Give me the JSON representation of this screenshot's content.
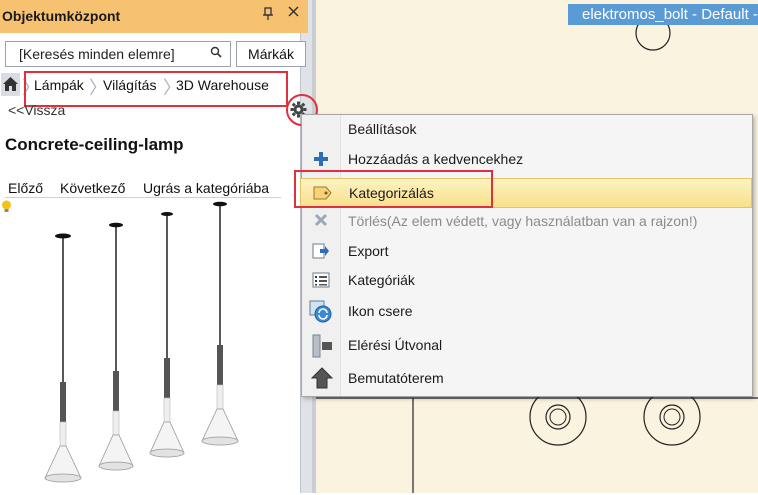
{
  "panel": {
    "title": "Objektumközpont",
    "pin_icon": "pin-icon",
    "close_icon": "close-icon"
  },
  "search": {
    "value": "[Keresés minden elemre]",
    "icon": "search-icon",
    "brands_label": "Márkák"
  },
  "breadcrumb": {
    "home_icon": "home-icon",
    "items": [
      "Lámpák",
      "Világítás",
      "3D Warehouse"
    ]
  },
  "back_label": "<<Vissza",
  "item_title": "Concrete-ceiling-lamp",
  "nav": {
    "prev": "Előző",
    "next": "Következő",
    "jump": "Ugrás a kategóriába"
  },
  "document_tab": "elektromos_bolt - Default -",
  "context_menu": {
    "items": [
      {
        "label": "Beállítások",
        "icon": "none",
        "enabled": true
      },
      {
        "label": "Hozzáadás a kedvencekhez",
        "icon": "plus-icon",
        "enabled": true
      },
      {
        "label": "Kategorizálás",
        "icon": "tag-icon",
        "enabled": true,
        "selected": true
      },
      {
        "label": "Törlés(Az elem védett, vagy használatban van a rajzon!)",
        "icon": "delete-icon",
        "enabled": false
      },
      {
        "label": "Export",
        "icon": "export-icon",
        "enabled": true
      },
      {
        "label": "Kategóriák",
        "icon": "categories-icon",
        "enabled": true
      },
      {
        "label": "Ikon csere",
        "icon": "icon-swap-icon",
        "enabled": true
      },
      {
        "label": "Elérési Útvonal",
        "icon": "path-icon",
        "enabled": true
      },
      {
        "label": "Bemutatóterem",
        "icon": "showroom-icon",
        "enabled": true
      }
    ]
  },
  "colors": {
    "panel_header": "#f6c272",
    "doc_tab": "#5b9bd5",
    "highlight_red": "#e0303b",
    "canvas": "#faf3df"
  }
}
